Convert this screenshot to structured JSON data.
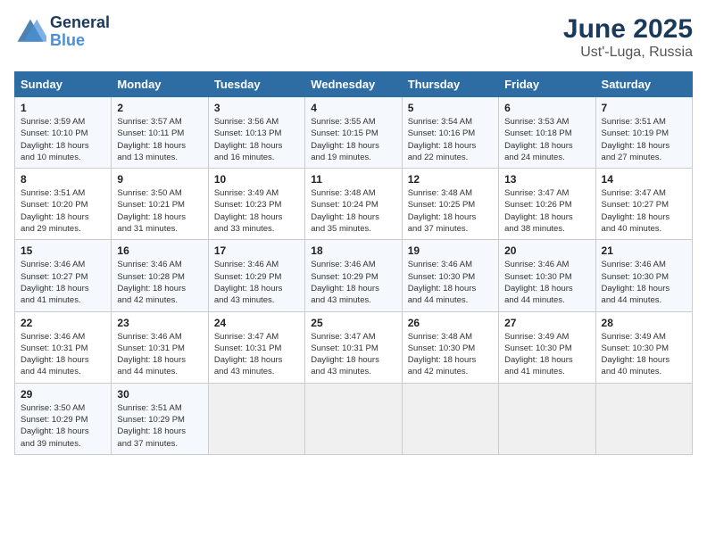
{
  "header": {
    "logo_line1": "General",
    "logo_line2": "Blue",
    "month": "June 2025",
    "location": "Ust'-Luga, Russia"
  },
  "days_of_week": [
    "Sunday",
    "Monday",
    "Tuesday",
    "Wednesday",
    "Thursday",
    "Friday",
    "Saturday"
  ],
  "weeks": [
    [
      {
        "day": "1",
        "info": "Sunrise: 3:59 AM\nSunset: 10:10 PM\nDaylight: 18 hours\nand 10 minutes."
      },
      {
        "day": "2",
        "info": "Sunrise: 3:57 AM\nSunset: 10:11 PM\nDaylight: 18 hours\nand 13 minutes."
      },
      {
        "day": "3",
        "info": "Sunrise: 3:56 AM\nSunset: 10:13 PM\nDaylight: 18 hours\nand 16 minutes."
      },
      {
        "day": "4",
        "info": "Sunrise: 3:55 AM\nSunset: 10:15 PM\nDaylight: 18 hours\nand 19 minutes."
      },
      {
        "day": "5",
        "info": "Sunrise: 3:54 AM\nSunset: 10:16 PM\nDaylight: 18 hours\nand 22 minutes."
      },
      {
        "day": "6",
        "info": "Sunrise: 3:53 AM\nSunset: 10:18 PM\nDaylight: 18 hours\nand 24 minutes."
      },
      {
        "day": "7",
        "info": "Sunrise: 3:51 AM\nSunset: 10:19 PM\nDaylight: 18 hours\nand 27 minutes."
      }
    ],
    [
      {
        "day": "8",
        "info": "Sunrise: 3:51 AM\nSunset: 10:20 PM\nDaylight: 18 hours\nand 29 minutes."
      },
      {
        "day": "9",
        "info": "Sunrise: 3:50 AM\nSunset: 10:21 PM\nDaylight: 18 hours\nand 31 minutes."
      },
      {
        "day": "10",
        "info": "Sunrise: 3:49 AM\nSunset: 10:23 PM\nDaylight: 18 hours\nand 33 minutes."
      },
      {
        "day": "11",
        "info": "Sunrise: 3:48 AM\nSunset: 10:24 PM\nDaylight: 18 hours\nand 35 minutes."
      },
      {
        "day": "12",
        "info": "Sunrise: 3:48 AM\nSunset: 10:25 PM\nDaylight: 18 hours\nand 37 minutes."
      },
      {
        "day": "13",
        "info": "Sunrise: 3:47 AM\nSunset: 10:26 PM\nDaylight: 18 hours\nand 38 minutes."
      },
      {
        "day": "14",
        "info": "Sunrise: 3:47 AM\nSunset: 10:27 PM\nDaylight: 18 hours\nand 40 minutes."
      }
    ],
    [
      {
        "day": "15",
        "info": "Sunrise: 3:46 AM\nSunset: 10:27 PM\nDaylight: 18 hours\nand 41 minutes."
      },
      {
        "day": "16",
        "info": "Sunrise: 3:46 AM\nSunset: 10:28 PM\nDaylight: 18 hours\nand 42 minutes."
      },
      {
        "day": "17",
        "info": "Sunrise: 3:46 AM\nSunset: 10:29 PM\nDaylight: 18 hours\nand 43 minutes."
      },
      {
        "day": "18",
        "info": "Sunrise: 3:46 AM\nSunset: 10:29 PM\nDaylight: 18 hours\nand 43 minutes."
      },
      {
        "day": "19",
        "info": "Sunrise: 3:46 AM\nSunset: 10:30 PM\nDaylight: 18 hours\nand 44 minutes."
      },
      {
        "day": "20",
        "info": "Sunrise: 3:46 AM\nSunset: 10:30 PM\nDaylight: 18 hours\nand 44 minutes."
      },
      {
        "day": "21",
        "info": "Sunrise: 3:46 AM\nSunset: 10:30 PM\nDaylight: 18 hours\nand 44 minutes."
      }
    ],
    [
      {
        "day": "22",
        "info": "Sunrise: 3:46 AM\nSunset: 10:31 PM\nDaylight: 18 hours\nand 44 minutes."
      },
      {
        "day": "23",
        "info": "Sunrise: 3:46 AM\nSunset: 10:31 PM\nDaylight: 18 hours\nand 44 minutes."
      },
      {
        "day": "24",
        "info": "Sunrise: 3:47 AM\nSunset: 10:31 PM\nDaylight: 18 hours\nand 43 minutes."
      },
      {
        "day": "25",
        "info": "Sunrise: 3:47 AM\nSunset: 10:31 PM\nDaylight: 18 hours\nand 43 minutes."
      },
      {
        "day": "26",
        "info": "Sunrise: 3:48 AM\nSunset: 10:30 PM\nDaylight: 18 hours\nand 42 minutes."
      },
      {
        "day": "27",
        "info": "Sunrise: 3:49 AM\nSunset: 10:30 PM\nDaylight: 18 hours\nand 41 minutes."
      },
      {
        "day": "28",
        "info": "Sunrise: 3:49 AM\nSunset: 10:30 PM\nDaylight: 18 hours\nand 40 minutes."
      }
    ],
    [
      {
        "day": "29",
        "info": "Sunrise: 3:50 AM\nSunset: 10:29 PM\nDaylight: 18 hours\nand 39 minutes."
      },
      {
        "day": "30",
        "info": "Sunrise: 3:51 AM\nSunset: 10:29 PM\nDaylight: 18 hours\nand 37 minutes."
      },
      {
        "day": "",
        "info": ""
      },
      {
        "day": "",
        "info": ""
      },
      {
        "day": "",
        "info": ""
      },
      {
        "day": "",
        "info": ""
      },
      {
        "day": "",
        "info": ""
      }
    ]
  ]
}
